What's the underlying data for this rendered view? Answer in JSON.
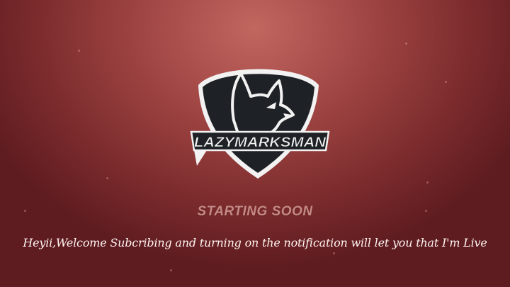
{
  "brand": {
    "name": "LAZYMARKSMAN"
  },
  "screen": {
    "status": "STARTING SOON",
    "message": "Heyii,Welcome Subcribing and turning on the notification will let you that I'm Live"
  },
  "colors": {
    "background_center": "#c26660",
    "background_edge": "#5e1c20",
    "shield_fill": "#1e2226",
    "status_text": "#c48a86",
    "message_text": "#fff4f0"
  },
  "icons": [
    "shield-logo-icon",
    "wolf-head-icon"
  ]
}
